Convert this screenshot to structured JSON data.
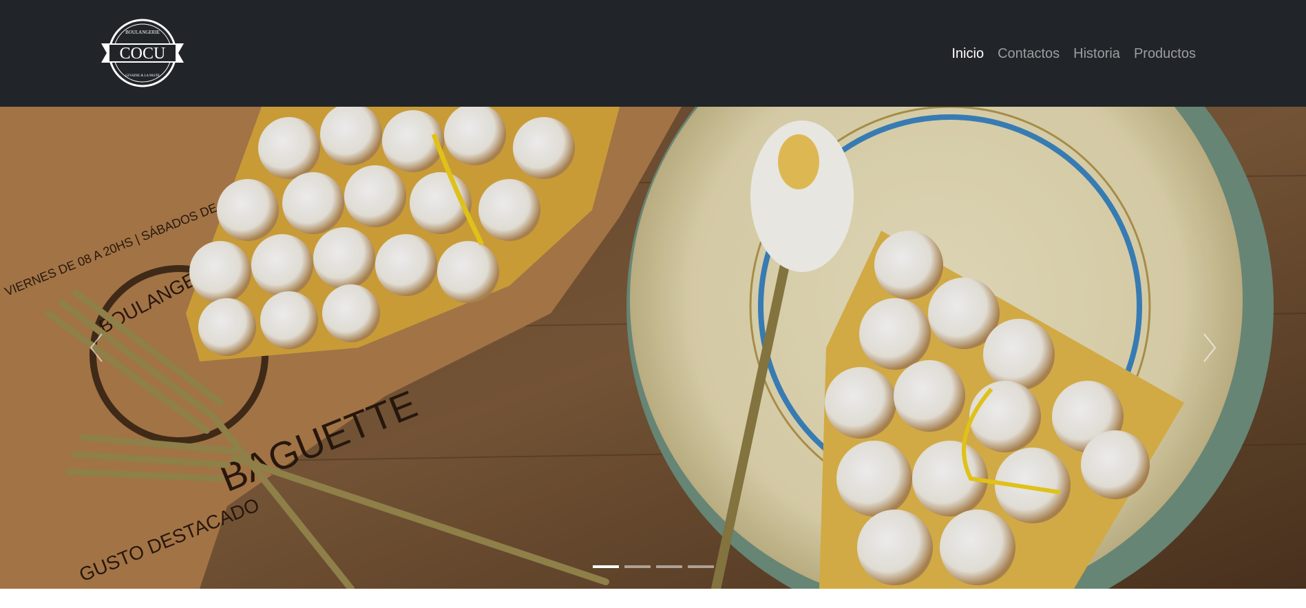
{
  "brand": {
    "name": "COCU",
    "arc_top": "BOULANGERIE",
    "arc_bottom": "LEVAINE & LA PASTE"
  },
  "nav": {
    "items": [
      {
        "label": "Inicio",
        "active": true
      },
      {
        "label": "Contactos",
        "active": false
      },
      {
        "label": "Historia",
        "active": false
      },
      {
        "label": "Productos",
        "active": false
      }
    ]
  },
  "carousel": {
    "slide_count": 4,
    "active_index": 0,
    "prev_icon": "chevron-left-icon",
    "next_icon": "chevron-right-icon",
    "paper_print": {
      "line1": "VIERNES DE 08 A 20HS | SÁBADOS DE 10 A 21HS Y DOMINGO",
      "line2": "BOULANGERIE",
      "line3": "BAGUETTE",
      "line4": "GUSTO DESTACADO"
    }
  },
  "colors": {
    "navbar_bg": "#212529",
    "nav_active": "#ffffff",
    "nav_inactive": "rgba(255,255,255,0.55)"
  }
}
